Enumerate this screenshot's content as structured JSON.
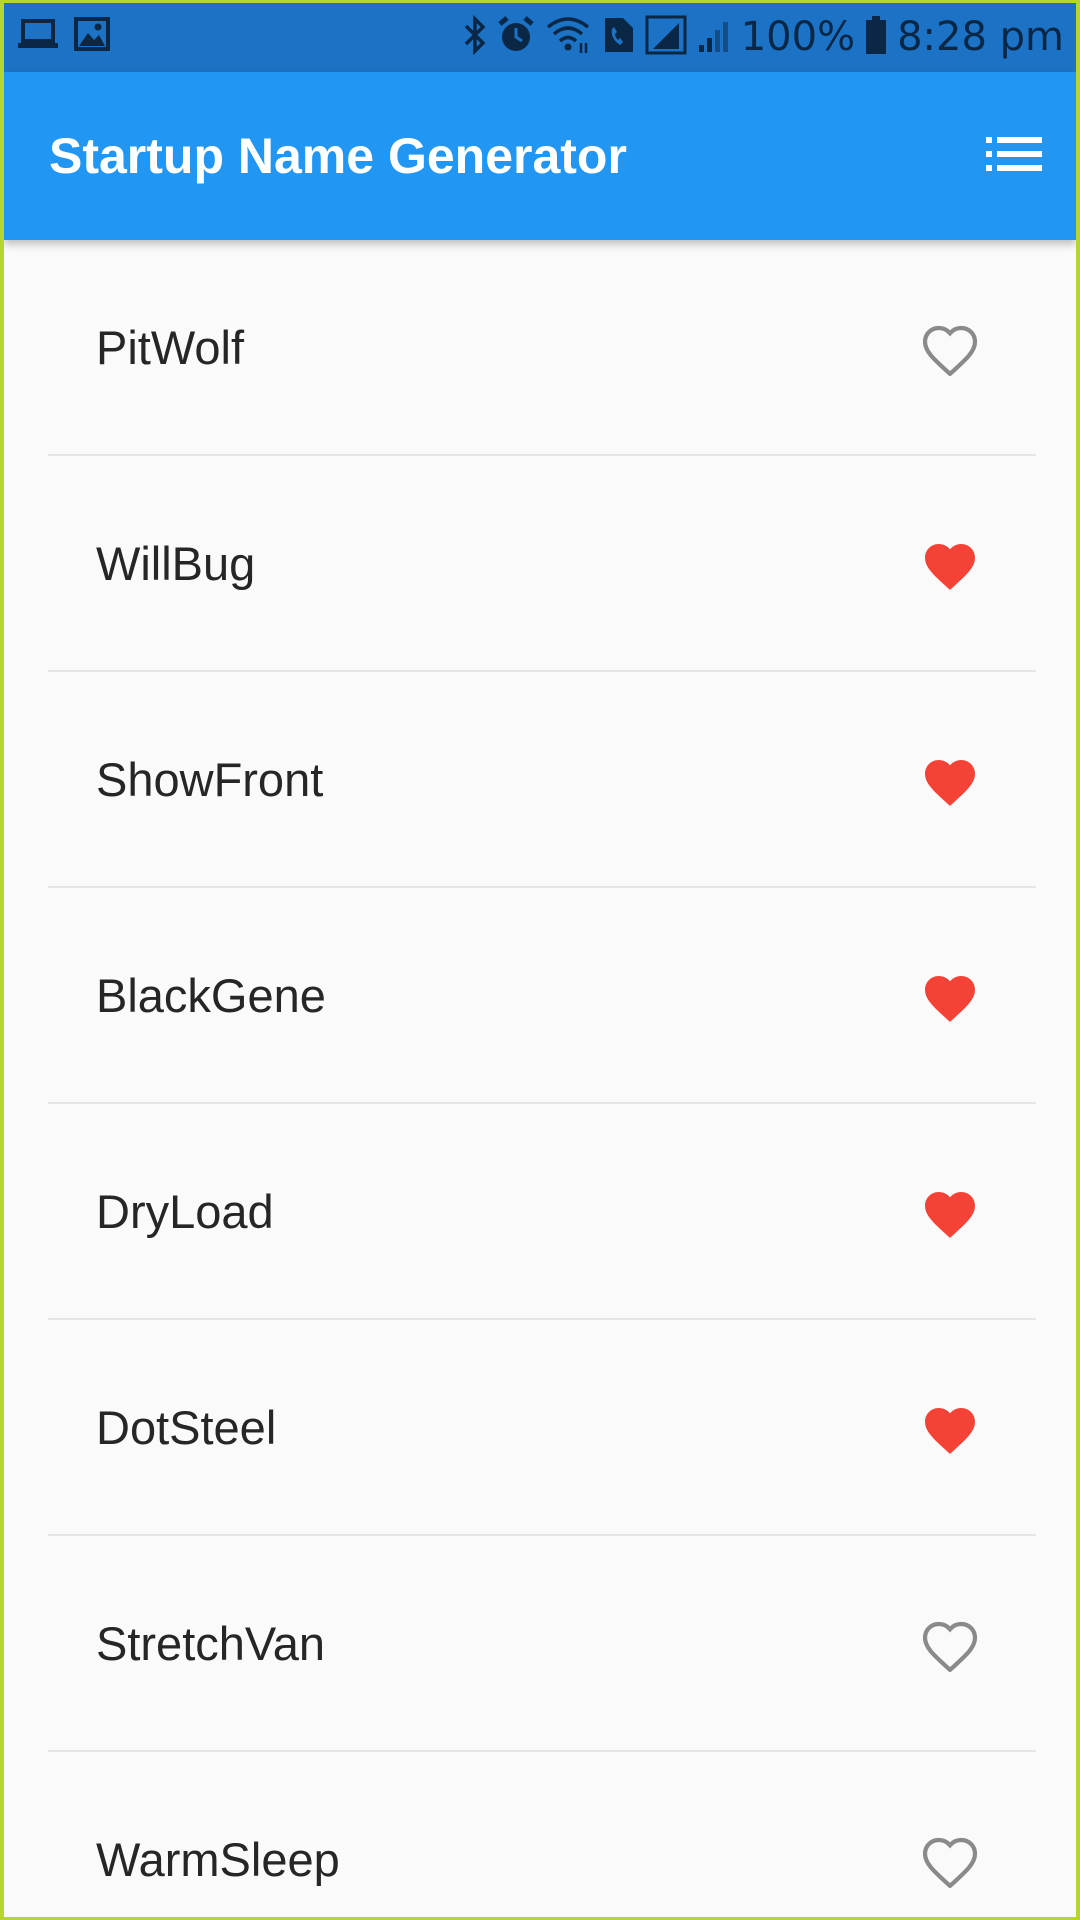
{
  "status_bar": {
    "battery": "100%",
    "time": "8:28 pm",
    "icons": [
      "laptop-icon",
      "image-icon",
      "bluetooth-icon",
      "alarm-icon",
      "wifi-icon",
      "wifi-calling-icon",
      "signal-icon",
      "signal-icon",
      "battery-icon"
    ]
  },
  "app_bar": {
    "title": "Startup Name Generator",
    "action_icon": "list-icon"
  },
  "colors": {
    "app_bar": "#2196f3",
    "status_bar": "#1c73c6",
    "favorite": "#f44336",
    "not_favorite": "#8a8a8a"
  },
  "list": {
    "items": [
      {
        "name": "PitWolf",
        "saved": false
      },
      {
        "name": "WillBug",
        "saved": true
      },
      {
        "name": "ShowFront",
        "saved": true
      },
      {
        "name": "BlackGene",
        "saved": true
      },
      {
        "name": "DryLoad",
        "saved": true
      },
      {
        "name": "DotSteel",
        "saved": true
      },
      {
        "name": "StretchVan",
        "saved": false
      },
      {
        "name": "WarmSleep",
        "saved": false
      }
    ]
  }
}
